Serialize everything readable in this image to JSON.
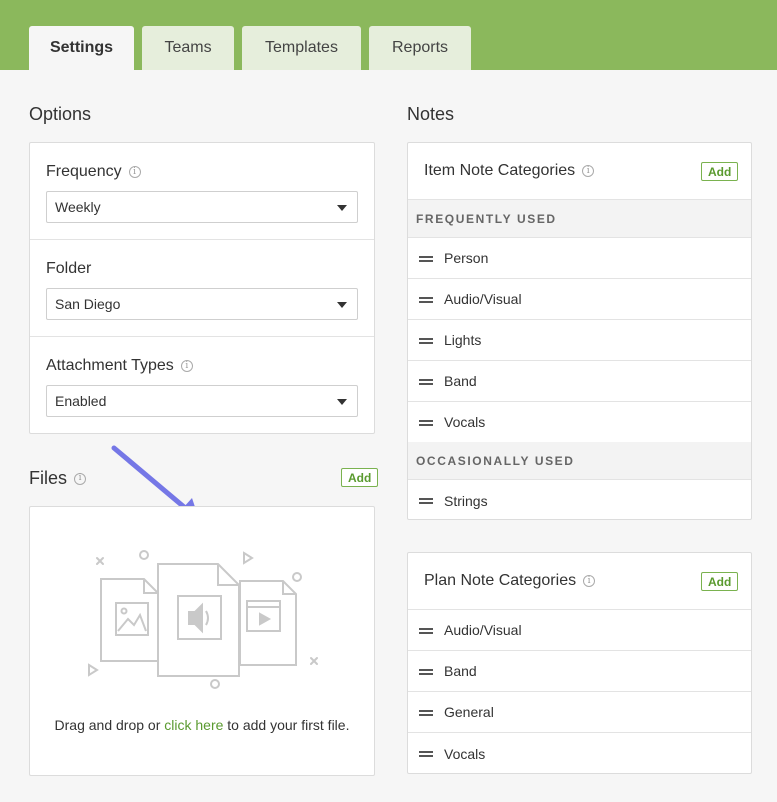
{
  "tabs": [
    {
      "label": "Settings",
      "active": true
    },
    {
      "label": "Teams",
      "active": false
    },
    {
      "label": "Templates",
      "active": false
    },
    {
      "label": "Reports",
      "active": false
    }
  ],
  "options": {
    "title": "Options",
    "fields": [
      {
        "label": "Frequency",
        "value": "Weekly",
        "has_info": true
      },
      {
        "label": "Folder",
        "value": "San Diego",
        "has_info": false
      },
      {
        "label": "Attachment Types",
        "value": "Enabled",
        "has_info": true
      }
    ]
  },
  "files": {
    "title": "Files",
    "add_label": "Add",
    "dropzone": {
      "prefix": "Drag and drop or ",
      "link": "click here",
      "suffix": " to add your first file."
    }
  },
  "notes": {
    "title": "Notes",
    "item_categories": {
      "title": "Item Note Categories",
      "add_label": "Add",
      "groups": [
        {
          "name": "FREQUENTLY USED",
          "items": [
            "Person",
            "Audio/Visual",
            "Lights",
            "Band",
            "Vocals"
          ]
        },
        {
          "name": "OCCASIONALLY USED",
          "items": [
            "Strings"
          ]
        }
      ]
    },
    "plan_categories": {
      "title": "Plan Note Categories",
      "add_label": "Add",
      "items": [
        "Audio/Visual",
        "Band",
        "General",
        "Vocals"
      ]
    }
  },
  "colors": {
    "topbar": "#8bb85c",
    "accent": "#5a9a2f",
    "arrow": "#7577e6"
  }
}
